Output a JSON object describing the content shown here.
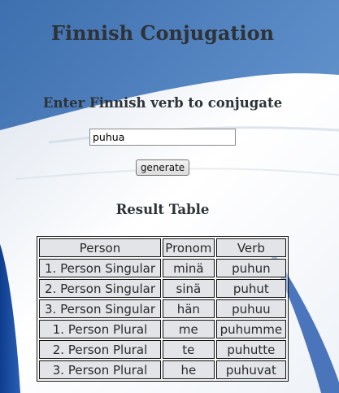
{
  "page": {
    "title": "Finnish Conjugation",
    "subtitle": "Enter Finnish verb to conjugate"
  },
  "form": {
    "verb_value": "puhua",
    "generate_label": "generate"
  },
  "result": {
    "title": "Result Table",
    "headers": [
      "Person",
      "Pronom",
      "Verb"
    ],
    "rows": [
      [
        "1. Person Singular",
        "minä",
        "puhun"
      ],
      [
        "2. Person Singular",
        "sinä",
        "puhut"
      ],
      [
        "3. Person Singular",
        "hän",
        "puhuu"
      ],
      [
        "1. Person Plural",
        "me",
        "puhumme"
      ],
      [
        "2. Person Plural",
        "te",
        "puhutte"
      ],
      [
        "3. Person Plural",
        "he",
        "puhuvat"
      ]
    ]
  },
  "colors": {
    "sky": "#4a7bb8",
    "flag_blue": "#1f4fa0",
    "flag_white": "#f4f6f9",
    "text": "#2e3338"
  }
}
